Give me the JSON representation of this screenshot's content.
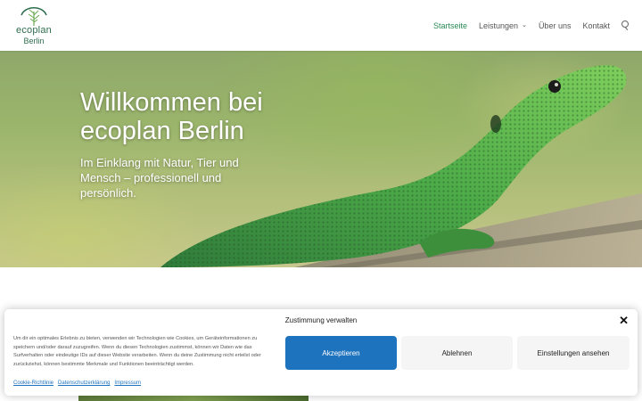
{
  "header": {
    "logo": {
      "word": "ecoplan",
      "sub": "Berlin"
    },
    "nav": [
      {
        "label": "Startseite",
        "active": true
      },
      {
        "label": "Leistungen",
        "dropdown": true
      },
      {
        "label": "Über uns"
      },
      {
        "label": "Kontakt"
      }
    ],
    "icons": {
      "search": "search-icon",
      "dropdown": "chevron-down-icon"
    }
  },
  "hero": {
    "title": "Willkommen bei ecoplan Berlin",
    "subtitle": "Im Einklang mit Natur, Tier und Mensch – professionell und persönlich."
  },
  "cookie": {
    "title": "Zustimmung verwalten",
    "message": "Um dir ein optimales Erlebnis zu bieten, verwenden wir Technologien wie Cookies, um Geräteinformationen zu speichern und/oder darauf zuzugreifen. Wenn du diesen Technologien zustimmst, können wir Daten wie das Surfverhalten oder eindeutige IDs auf dieser Website verarbeiten. Wenn du deine Zustimmung nicht erteilst oder zurückziehst, können bestimmte Merkmale und Funktionen beeinträchtigt werden.",
    "buttons": {
      "accept": "Akzeptieren",
      "deny": "Ablehnen",
      "preferences": "Einstellungen ansehen"
    },
    "links": [
      "Cookie-Richtlinie",
      "Datenschutzerklärung",
      "Impressum"
    ],
    "close_icon": "close-icon"
  },
  "colors": {
    "brand": "#2a8a56",
    "accept": "#1e73be",
    "logo": "#2f6f4f"
  }
}
